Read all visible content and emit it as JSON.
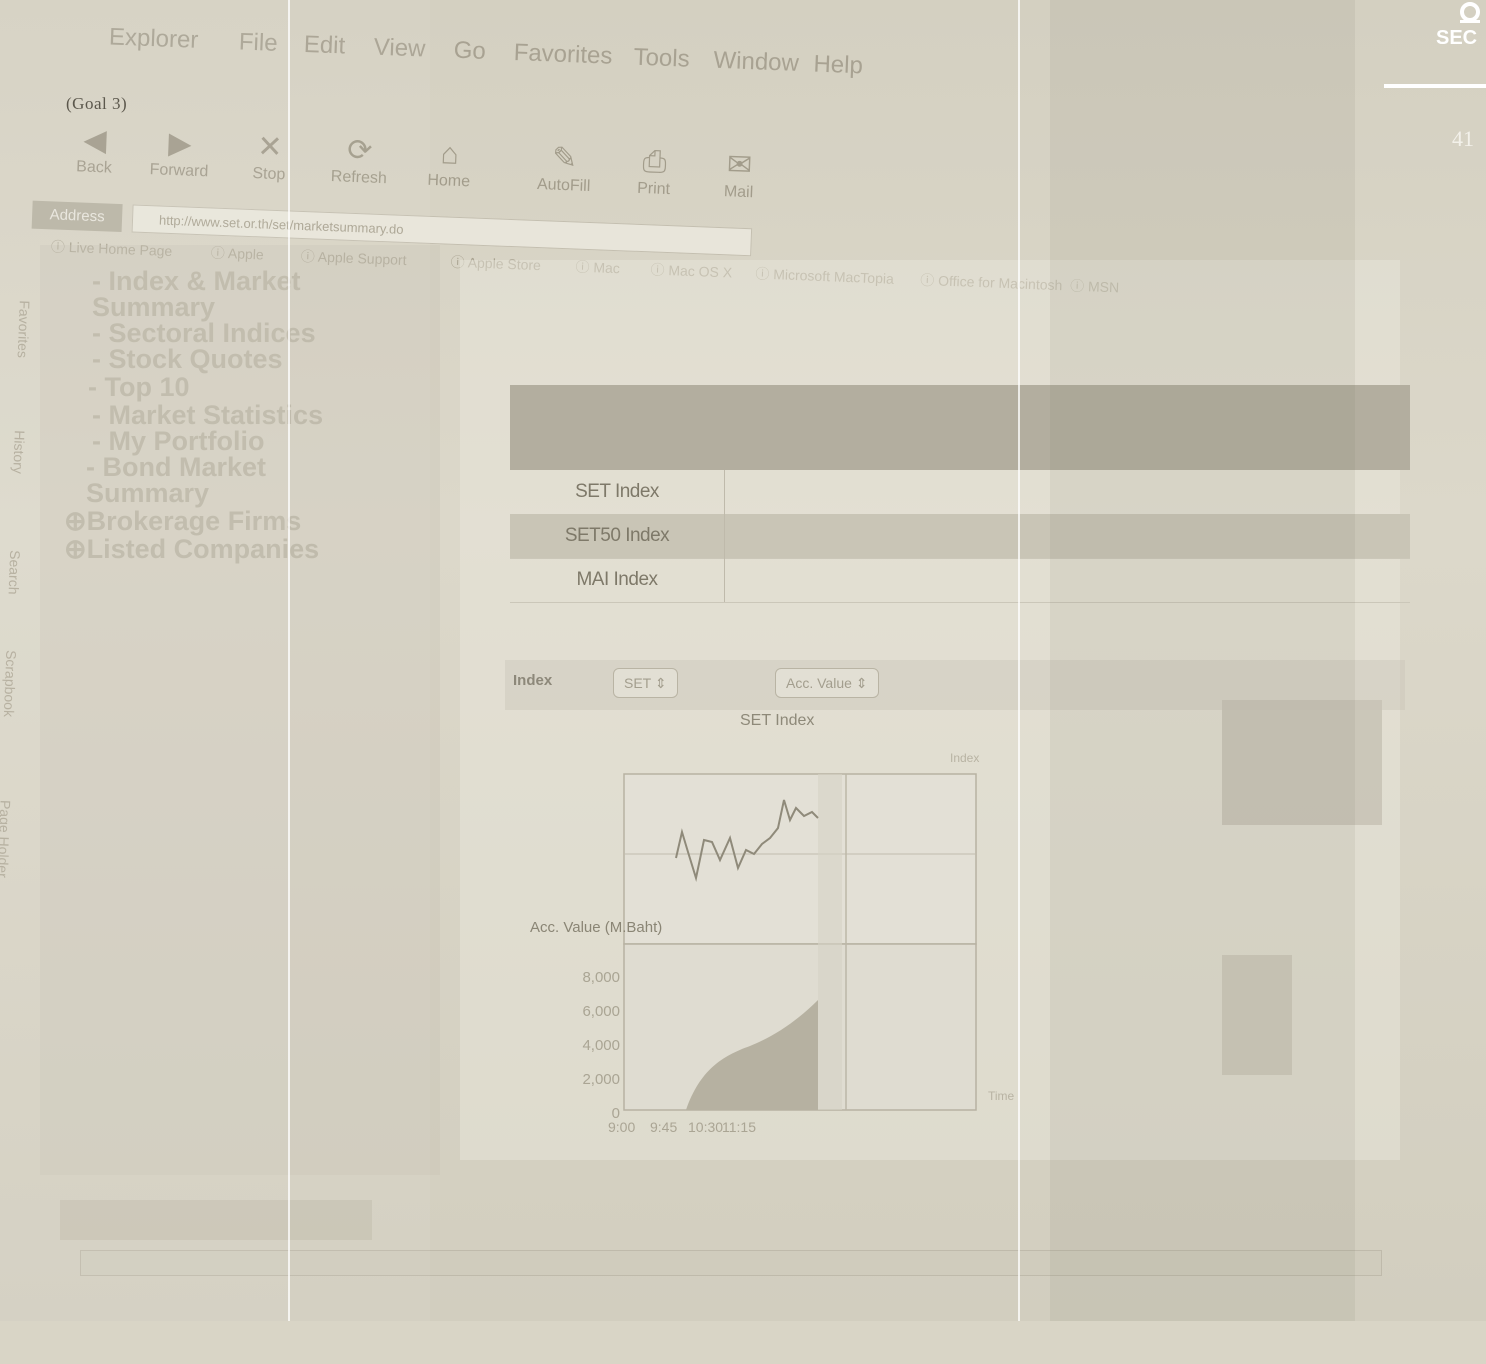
{
  "slide": {
    "goal_label": "(Goal 3)",
    "page_number": "41",
    "logo_text": "SEC"
  },
  "browser": {
    "menu": [
      "Explorer",
      "File",
      "Edit",
      "View",
      "Go",
      "Favorites",
      "Tools",
      "Window",
      "Help"
    ],
    "toolbar": [
      {
        "label": "Back",
        "icon": "back-arrow-icon"
      },
      {
        "label": "Forward",
        "icon": "forward-arrow-icon"
      },
      {
        "label": "Stop",
        "icon": "stop-icon"
      },
      {
        "label": "Refresh",
        "icon": "refresh-icon"
      },
      {
        "label": "Home",
        "icon": "home-icon"
      },
      {
        "label": "AutoFill",
        "icon": "autofill-icon"
      },
      {
        "label": "Print",
        "icon": "printer-icon"
      },
      {
        "label": "Mail",
        "icon": "mail-icon"
      }
    ],
    "address_label": "Address",
    "address_url": "http://www.set.or.th/set/marketsummary.do",
    "bookmarks": [
      "Live Home Page",
      "Apple",
      "Apple Support",
      "Apple Store",
      "Mac",
      "Mac OS X",
      "Microsoft MacTopia",
      "Office for Macintosh",
      "MSN"
    ],
    "side_tabs": [
      "Favorites",
      "History",
      "Search",
      "Scrapbook",
      "Page Holder"
    ]
  },
  "nav": {
    "items": [
      "- Index & Market",
      "Summary",
      "- Sectoral Indices",
      "- Stock Quotes",
      "- Top 10",
      "- Market Statistics",
      "- My Portfolio",
      "- Bond Market",
      "Summary",
      "Brokerage Firms",
      "Listed Companies"
    ]
  },
  "market_table": {
    "rows": [
      {
        "name": "SET Index"
      },
      {
        "name": "SET50 Index"
      },
      {
        "name": "MAI Index"
      }
    ]
  },
  "chart_controls": {
    "index_label": "Index",
    "index_select": "SET",
    "value_select": "Acc. Value"
  },
  "chart_data": {
    "type": "line",
    "title": "SET Index",
    "ylabel": "Acc. Value (M.Baht)",
    "y_right_label": "Index",
    "x_right_label": "Time",
    "acc_value_ticks": [
      "8,000",
      "6,000",
      "4,000",
      "2,000",
      "0"
    ],
    "x_ticks": [
      "9:00",
      "9:45",
      "10:30",
      "11:15"
    ]
  }
}
